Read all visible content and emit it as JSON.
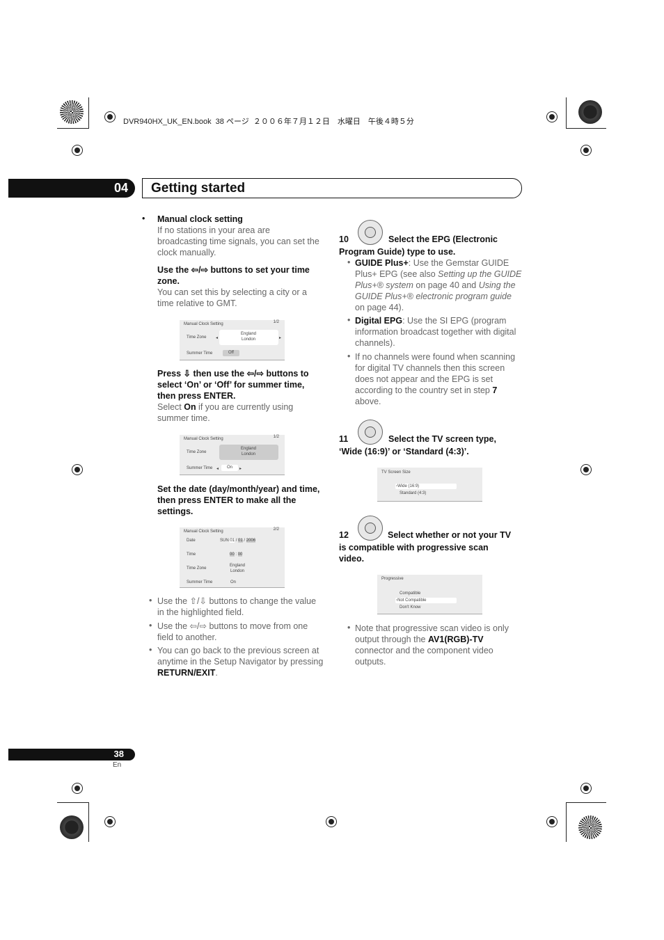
{
  "print_header": "DVR940HX_UK_EN.book  38 ページ  ２００６年７月１２日　水曜日　午後４時５分",
  "chapter": {
    "number": "04",
    "title": "Getting started"
  },
  "footer": {
    "page": "38",
    "lang": "En"
  },
  "left": {
    "manual_title": "Manual clock setting",
    "manual_body": "If no stations in your area are broadcasting time signals, you can set the clock manually.",
    "step1_head": "Use the ⇦/⇨ buttons to set your time zone.",
    "step1_body": "You can set this by selecting a city or a time relative to GMT.",
    "step2_head": "Press ⇩ then use the ⇦/⇨ buttons to select ‘On’ or ‘Off’ for summer time, then press ENTER.",
    "step2_body_a": "Select ",
    "step2_body_b": "On",
    "step2_body_c": " if you are currently using summer time.",
    "step3_head": "Set the date (day/month/year) and time, then press ENTER to make all the settings.",
    "bullets": [
      {
        "a": "Use the ⇧/⇩ buttons to change the value in the highlighted field."
      },
      {
        "a": "Use the ⇦/⇨ buttons to move from one field to another."
      },
      {
        "a": "You can go back to the previous screen at anytime in the Setup Navigator by pressing ",
        "b": "RETURN/EXIT",
        "c": "."
      }
    ]
  },
  "screens": {
    "s1": {
      "title": "Manual Clock Setting",
      "page": "1/2",
      "tz_label": "Time Zone",
      "tz1": "England",
      "tz2": "London",
      "st_label": "Summer Time",
      "st_value": "Off"
    },
    "s2": {
      "title": "Manual Clock Setting",
      "page": "1/2",
      "tz_label": "Time Zone",
      "tz1": "England",
      "tz2": "London",
      "st_label": "Summer Time",
      "st_value": "On"
    },
    "s3": {
      "title": "Manual Clock Setting",
      "page": "2/2",
      "date_label": "Date",
      "dow": "SUN",
      "day": "01",
      "month": "01",
      "year": "2006",
      "time_label": "Time",
      "hh": "00",
      "mm": "00",
      "tz_label": "Time Zone",
      "tz1": "England",
      "tz2": "London",
      "st_label": "Summer Time",
      "st_value": "On"
    },
    "tv": {
      "title": "TV Screen Size",
      "opt1": "Wide (16:9)",
      "opt2": "Standard (4:3)"
    },
    "prog": {
      "title": "Progressive",
      "opt1": "Compatible",
      "opt2": "Not Compatible",
      "opt3": "Don't Know"
    }
  },
  "right": {
    "s10_num": "10",
    "s10_head1": "Select the EPG (Electronic",
    "s10_head2": "Program Guide) type to use.",
    "b1_bold": "GUIDE Plus+",
    "b1_a": ": Use the Gemstar GUIDE Plus+ EPG (see also ",
    "b1_i1": "Setting up the GUIDE Plus+® system",
    "b1_b": " on page 40 and ",
    "b1_i2": "Using the GUIDE Plus+® electronic program guide",
    "b1_c": " on page 44).",
    "b2_bold": "Digital EPG",
    "b2_a": ": Use the SI EPG (program information broadcast together with digital channels).",
    "b3_a": "If no channels were found when scanning for digital TV channels then this screen does not appear and the EPG is set according to the country set in step ",
    "b3_bold": "7",
    "b3_b": " above.",
    "s11_num": "11",
    "s11_head1": "Select the TV screen type,",
    "s11_head2": "‘Wide (16:9)’ or ‘Standard (4:3)’.",
    "s12_num": "12",
    "s12_head1": "Select whether or not your TV",
    "s12_head2": "is compatible with progressive scan video.",
    "note_a": "Note that progressive scan video is only output through the ",
    "note_bold": "AV1(RGB)-TV",
    "note_b": " connector and the component video outputs."
  }
}
